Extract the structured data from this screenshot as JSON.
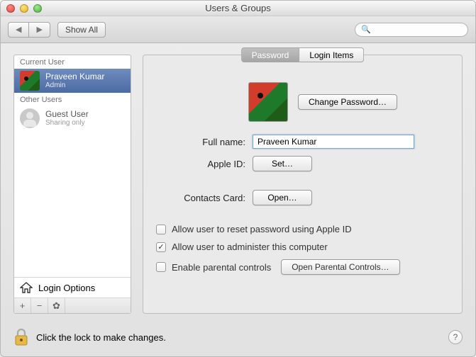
{
  "window": {
    "title": "Users & Groups"
  },
  "toolbar": {
    "show_all": "Show All",
    "search_placeholder": ""
  },
  "sidebar": {
    "current_header": "Current User",
    "other_header": "Other Users",
    "current": {
      "name": "Praveen Kumar",
      "role": "Admin"
    },
    "other": {
      "name": "Guest User",
      "role": "Sharing only"
    },
    "login_options": "Login Options"
  },
  "tabs": {
    "password": "Password",
    "login_items": "Login Items"
  },
  "buttons": {
    "change_password": "Change Password…",
    "set": "Set…",
    "open": "Open…",
    "open_parental": "Open Parental Controls…"
  },
  "labels": {
    "full_name": "Full name:",
    "apple_id": "Apple ID:",
    "contacts_card": "Contacts Card:"
  },
  "fields": {
    "full_name_value": "Praveen Kumar"
  },
  "checks": {
    "reset_pw": "Allow user to reset password using Apple ID",
    "administer": "Allow user to administer this computer",
    "parental": "Enable parental controls"
  },
  "footer": {
    "lock_text": "Click the lock to make changes."
  }
}
